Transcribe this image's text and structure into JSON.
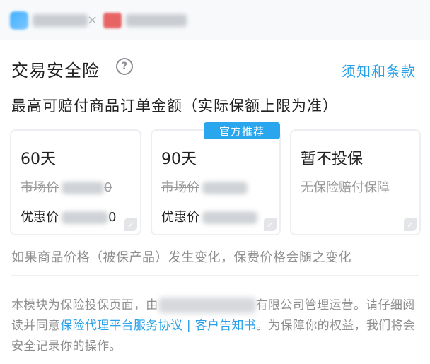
{
  "header": {
    "left_brand_text": "",
    "separator": "×",
    "right_brand_text": ""
  },
  "insurance": {
    "title": "交易安全险",
    "terms_link": "须知和条款",
    "subtitle": "最高可赔付商品订单金额（实际保额上限为准）",
    "badge": "官方推荐",
    "options": [
      {
        "name": "60天",
        "orig_label": "市场价",
        "orig_tail": "0",
        "disc_label": "优惠价",
        "disc_tail": "0"
      },
      {
        "name": "90天",
        "orig_label": "市场价",
        "orig_tail": "",
        "disc_label": "优惠价",
        "disc_tail": ""
      },
      {
        "name": "暂不投保",
        "desc": "无保险赔付保障"
      }
    ],
    "notice": "如果商品价格（被保产品）发生变化，保费价格会随之变化"
  },
  "footer": {
    "part1": "本模块为保险投保页面，由",
    "part2": "有限公司管理运营。请仔细阅读并同意",
    "link1": "保险代理平台服务协议",
    "sep": " | ",
    "link2": "客户告知书",
    "part3": "。为保障你的权益，我们将会安全记录你的操作。"
  },
  "colors": {
    "accent": "#29a1e9",
    "badge": "#2aa6ee"
  },
  "icons": {
    "help": "question-circle-icon",
    "check": "check-icon"
  }
}
